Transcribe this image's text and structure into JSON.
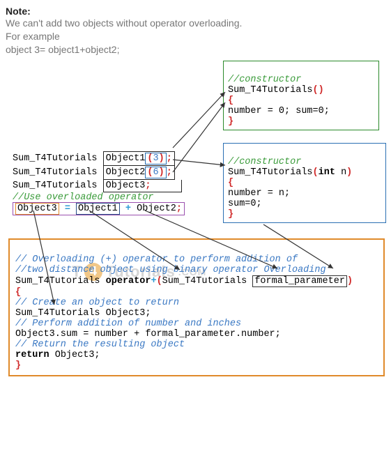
{
  "note": {
    "title": "Note:",
    "line1": "We can't add two objects without operator overloading.",
    "line2": "For example",
    "line3": "object 3= object1+object2;"
  },
  "decl": {
    "type": "Sum_T4Tutorials",
    "o1": "Object1",
    "o1arg": "3",
    "o2": "Object2",
    "o2arg": "6",
    "o3": "Object3",
    "use_comment": "//Use overloaded operator",
    "assign_lhs": "Object3",
    "eq": "=",
    "rhs1": "Object1",
    "plus": "+",
    "rhs2": "Object2"
  },
  "ctor1": {
    "comment": "//constructor",
    "name": "Sum_T4Tutorials",
    "body": "number = 0; sum=0;"
  },
  "ctor2": {
    "comment": "//constructor",
    "name": "Sum_T4Tutorials",
    "param_type": "int",
    "param_name": "n",
    "body1": "number = n;",
    "body2": "sum=0;"
  },
  "opfunc": {
    "c1": "// Overloading (+) operator to perform addition of",
    "c2": "//two distance object using binary operator Overloading",
    "ret": "Sum_T4Tutorials",
    "kw": "operator",
    "plus": "+",
    "ptype": "Sum_T4Tutorials",
    "pname": "formal_parameter",
    "c3": "// Create an object to return",
    "decl": "Sum_T4Tutorials Object3;",
    "c4": "// Perform addition of number and inches",
    "assign": "Object3.sum = number + formal_parameter.number;",
    "c5": "// Return the resulting object",
    "ret_kw": "return",
    "ret_obj": "Object3;"
  },
  "watermark": {
    "t": "T",
    "four": "4",
    "rest": "Tutorials",
    "dot": ".COM"
  }
}
